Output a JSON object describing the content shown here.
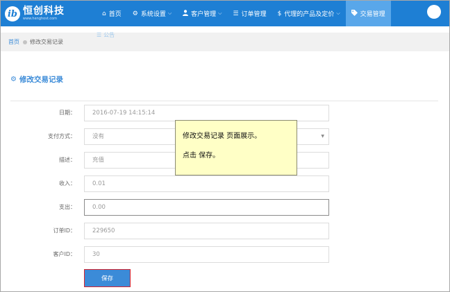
{
  "logo": {
    "mark": "ib",
    "name": "恒创科技",
    "url": "www.henghost.com"
  },
  "nav": [
    {
      "icon": "home-icon",
      "glyph": "⌂",
      "label": "首页",
      "dropdown": false,
      "active": false
    },
    {
      "icon": "gear-icon",
      "glyph": "⚙",
      "label": "系统设置",
      "dropdown": true,
      "active": false
    },
    {
      "icon": "user-icon",
      "glyph": "👤",
      "label": "客户管理",
      "dropdown": true,
      "active": false
    },
    {
      "icon": "list-icon",
      "glyph": "☰",
      "label": "订单管理",
      "dropdown": false,
      "active": false
    },
    {
      "icon": "dollar-icon",
      "glyph": "$",
      "label": "代理的产品及定价",
      "dropdown": true,
      "active": false
    },
    {
      "icon": "tag-icon",
      "glyph": "◆",
      "label": "交易管理",
      "dropdown": false,
      "active": true
    }
  ],
  "sub_nav": {
    "label": "公告"
  },
  "breadcrumb": {
    "home": "首页",
    "current": "修改交易记录"
  },
  "section": {
    "title": "修改交易记录"
  },
  "form": {
    "date": {
      "label": "日期：",
      "value": "2016-07-19 14:15:14"
    },
    "payment": {
      "label": "支付方式：",
      "value": "没有"
    },
    "description": {
      "label": "描述：",
      "value": "充值"
    },
    "income": {
      "label": "收入：",
      "value": "0.01"
    },
    "expense": {
      "label": "支出：",
      "value": "0.00"
    },
    "order_id": {
      "label": "订单ID：",
      "value": "229650"
    },
    "customer_id": {
      "label": "客户ID：",
      "value": "30"
    }
  },
  "save_label": "保存",
  "tooltip": {
    "line1": "修改交易记录 页面展示。",
    "line2": "点击 保存。"
  },
  "colors": {
    "primary": "#1e7fd4",
    "accent": "#3b8bd8",
    "highlight": "#d9232d",
    "tooltip_bg": "#ffffc6"
  }
}
